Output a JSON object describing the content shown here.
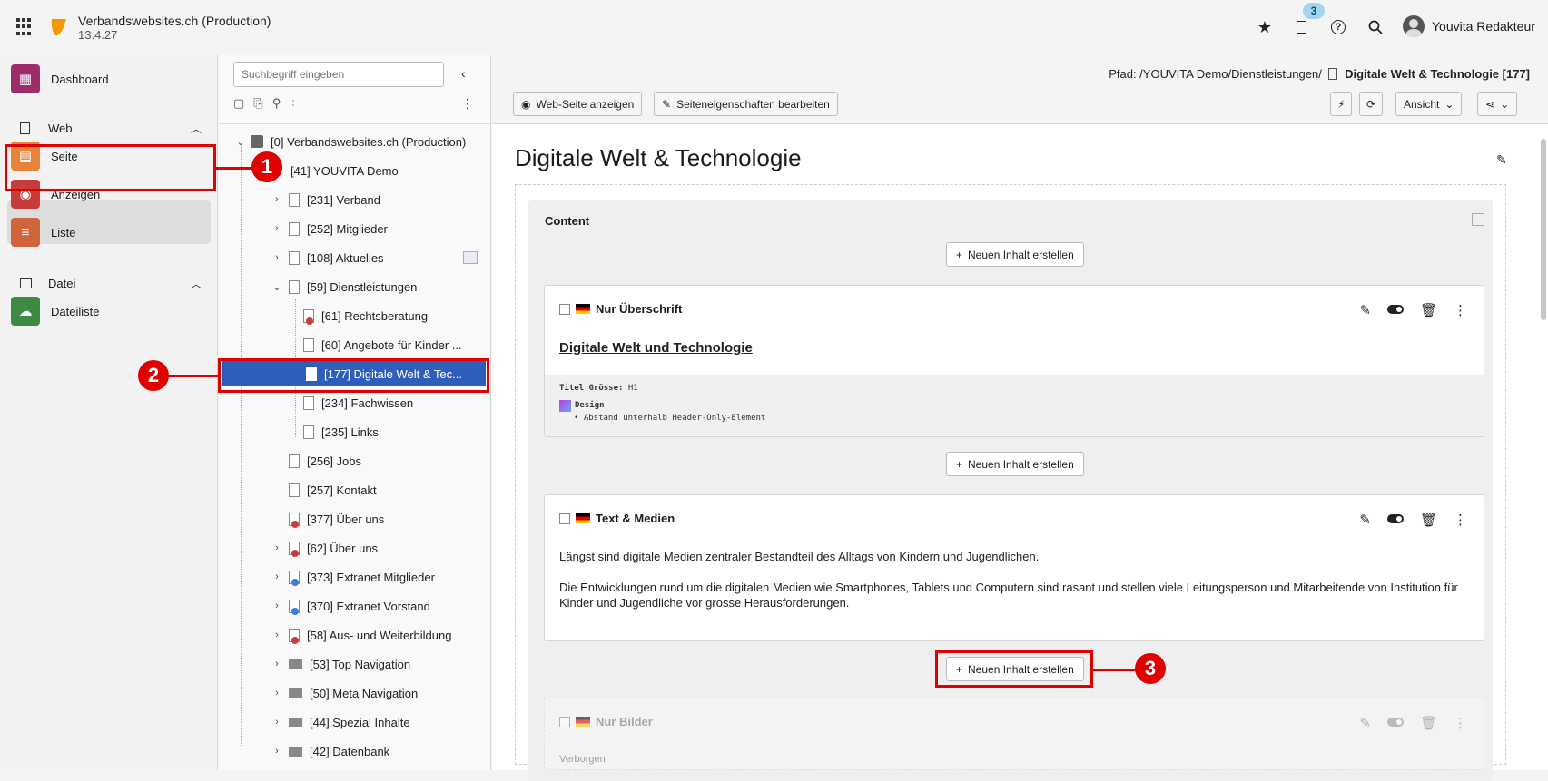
{
  "topbar": {
    "site_name": "Verbandswebsites.ch (Production)",
    "version": "13.4.27",
    "notification_count": "3",
    "user_name": "Youvita Redakteur"
  },
  "modules": {
    "dashboard": "Dashboard",
    "web_group": "Web",
    "seite": "Seite",
    "anzeigen": "Anzeigen",
    "liste": "Liste",
    "datei_group": "Datei",
    "dateiliste": "Dateiliste"
  },
  "tree": {
    "search_placeholder": "Suchbegriff eingeben",
    "nodes": [
      "[0] Verbandswebsites.ch (Production)",
      "[41] YOUVITA Demo",
      "[231] Verband",
      "[252] Mitglieder",
      "[108] Aktuelles",
      "[59] Dienstleistungen",
      "[61] Rechtsberatung",
      "[60] Angebote für Kinder ...",
      "[177] Digitale Welt & Tec...",
      "[234] Fachwissen",
      "[235] Links",
      "[256] Jobs",
      "[257] Kontakt",
      "[377] Über uns",
      "[62] Über uns",
      "[373] Extranet Mitglieder",
      "[370] Extranet Vorstand",
      "[58] Aus- und Weiterbildung",
      "[53] Top Navigation",
      "[50] Meta Navigation",
      "[44] Spezial Inhalte",
      "[42] Datenbank"
    ]
  },
  "docheader": {
    "path_label": "Pfad: /YOUVITA Demo/Dienstleistungen/",
    "path_page": "Digitale Welt & Technologie [177]",
    "view_button": "Web-Seite anzeigen",
    "edit_props_button": "Seiteneigenschaften bearbeiten",
    "ansicht": "Ansicht"
  },
  "page": {
    "title": "Digitale Welt & Technologie",
    "column_title": "Content",
    "new_content": "Neuen Inhalt erstellen",
    "card1": {
      "type": "Nur Überschrift",
      "headline": "Digitale Welt und Technologie",
      "meta_label": "Titel Grösse:",
      "meta_value": "H1",
      "design": "Design",
      "design_item": "Abstand unterhalb Header-Only-Element"
    },
    "card2": {
      "type": "Text & Medien",
      "p1": "Längst sind digitale Medien zentraler Bestandteil des Alltags von Kindern und Jugendlichen.",
      "p2": "Die Entwicklungen rund um die digitalen Medien wie Smartphones, Tablets und Computern sind rasant und stellen viele Leitungsperson und Mitarbeitende von Institution für Kinder und Jugendliche vor grosse Herausforderungen."
    },
    "card3": {
      "type": "Nur Bilder",
      "status": "Verborgen"
    }
  },
  "callouts": [
    "1",
    "2",
    "3"
  ],
  "colors": {
    "accent": "#2d5ebc",
    "callout": "#e00000",
    "dashboard": "#9e2b6a",
    "seite": "#e8843a",
    "anzeigen": "#c93a3a",
    "liste": "#d0643a",
    "dateiliste": "#3f8a43"
  }
}
